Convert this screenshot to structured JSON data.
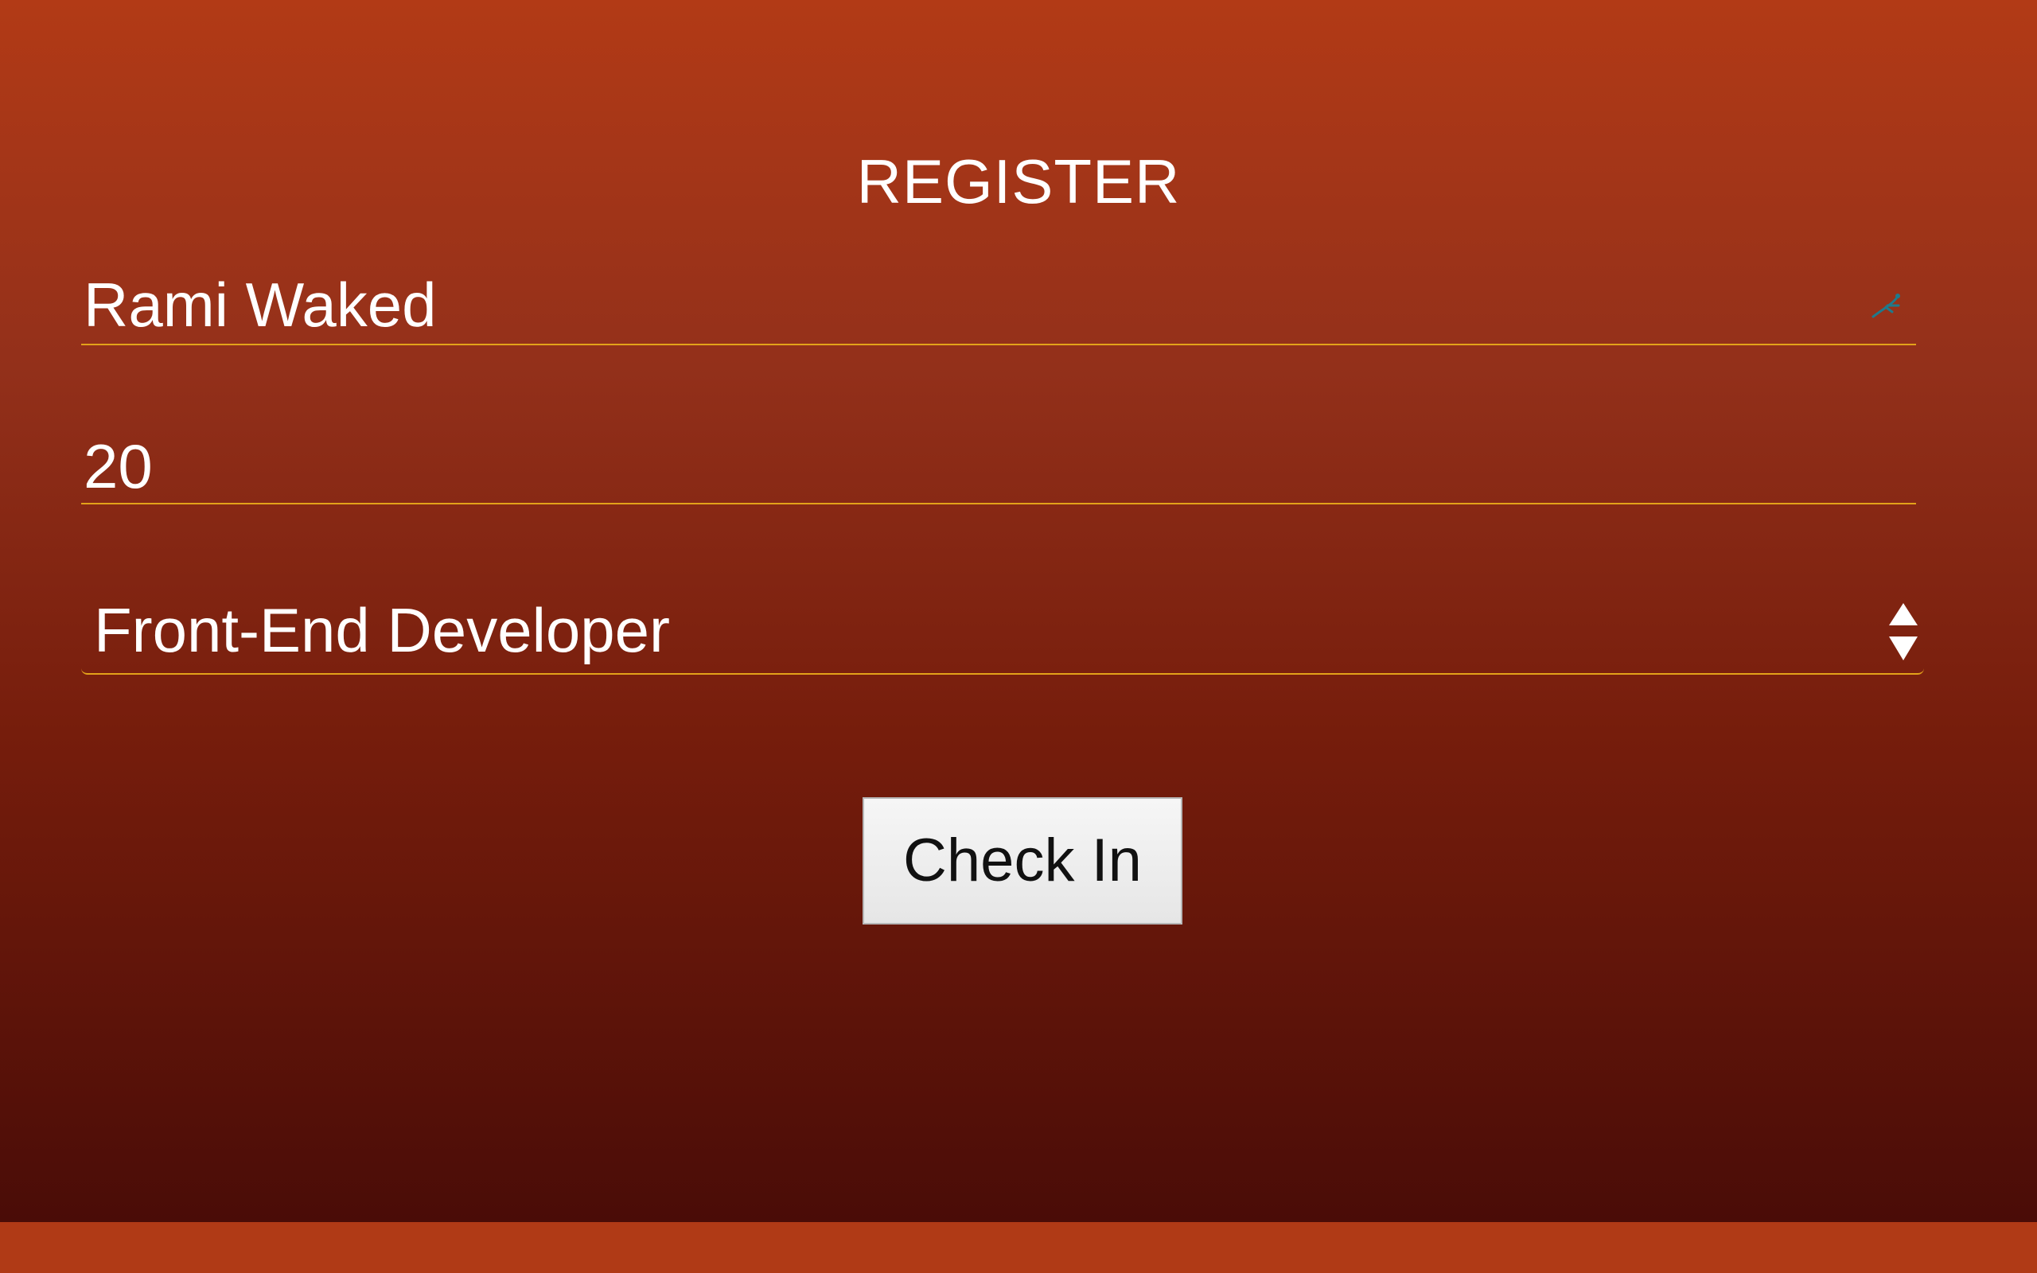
{
  "form": {
    "title": "REGISTER",
    "name_field": {
      "value": "Rami Waked",
      "autofill_icon": "autofill-runner-icon"
    },
    "age_field": {
      "value": "20"
    },
    "role_select": {
      "selected": "Front-End Developer",
      "icon": "up-down-stepper-icon"
    },
    "submit_label": "Check In"
  },
  "colors": {
    "gradient_top": "#b23a16",
    "gradient_bottom": "#4a0c07",
    "footer": "#b03a16",
    "underline": "#e3a21a",
    "text": "#ffffff",
    "button_bg": "#eeeeee"
  }
}
